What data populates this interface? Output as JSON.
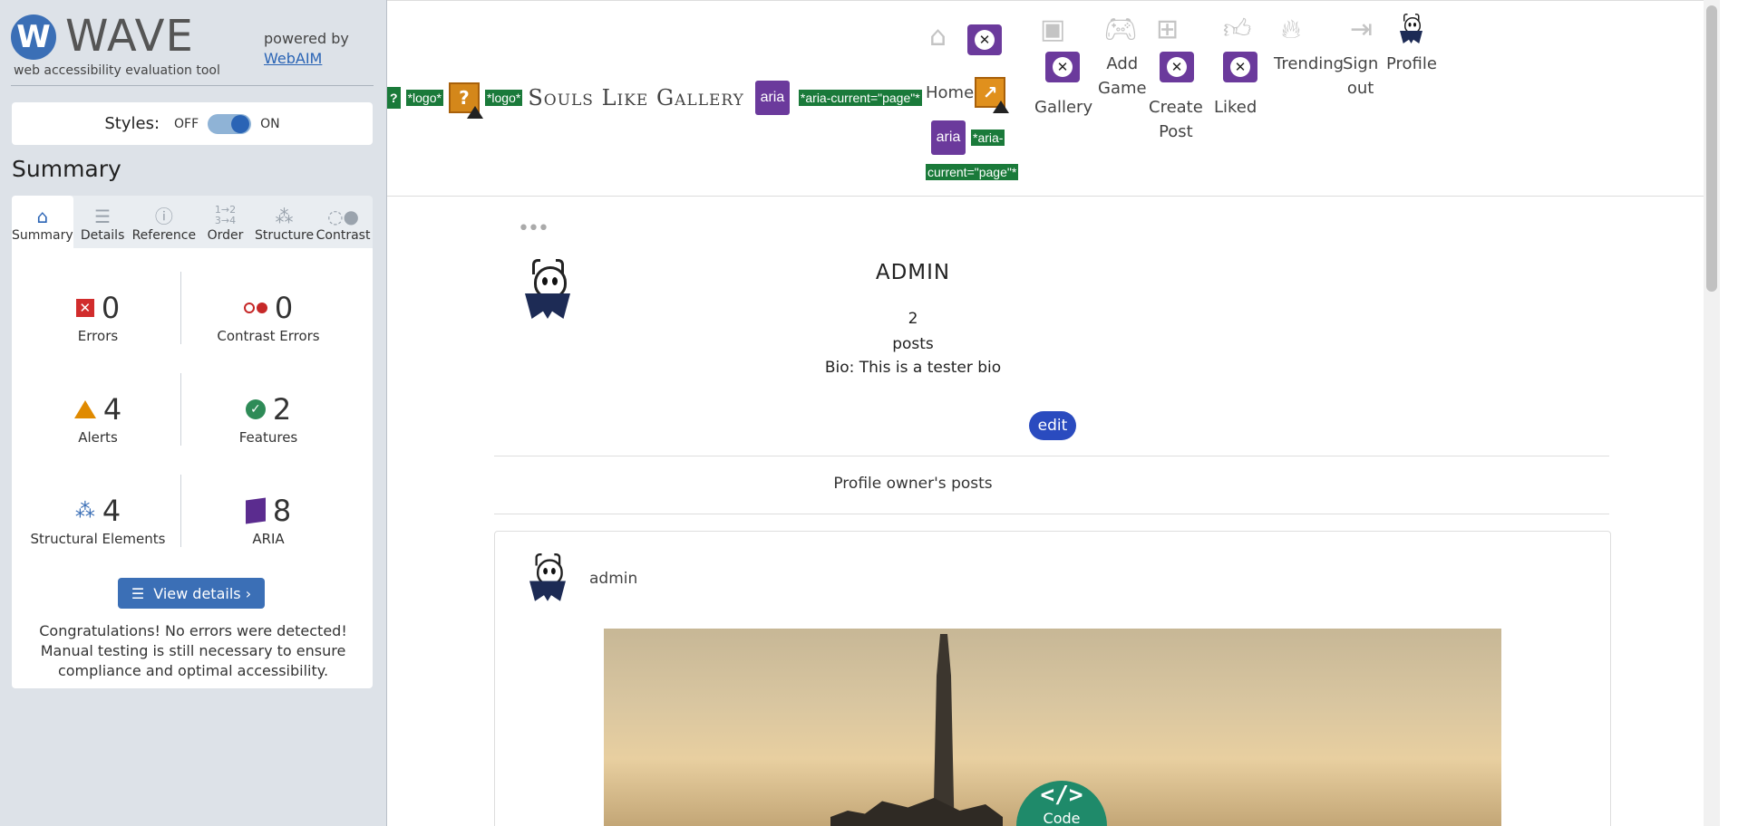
{
  "wave": {
    "logo_letter": "W",
    "logo_text": "WAVE",
    "tagline": "web accessibility evaluation tool",
    "powered_by": "powered by",
    "powered_link": "WebAIM",
    "styles_label": "Styles:",
    "styles_off": "OFF",
    "styles_on": "ON",
    "summary_heading": "Summary",
    "tabs": [
      {
        "label": "Summary",
        "icon": "home-icon",
        "active": true
      },
      {
        "label": "Details",
        "icon": "list-icon",
        "active": false
      },
      {
        "label": "Reference",
        "icon": "info-icon",
        "active": false
      },
      {
        "label": "Order",
        "icon": "order-icon",
        "active": false
      },
      {
        "label": "Structure",
        "icon": "structure-icon",
        "active": false
      },
      {
        "label": "Contrast",
        "icon": "contrast-icon",
        "active": false
      }
    ],
    "stats": {
      "errors": {
        "count": "0",
        "label": "Errors"
      },
      "contrast_errors": {
        "count": "0",
        "label": "Contrast Errors"
      },
      "alerts": {
        "count": "4",
        "label": "Alerts"
      },
      "features": {
        "count": "2",
        "label": "Features"
      },
      "structural": {
        "count": "4",
        "label": "Structural Elements"
      },
      "aria": {
        "count": "8",
        "label": "ARIA"
      }
    },
    "view_details": "View details ›",
    "congrats": "Congratulations! No errors were detected! Manual testing is still necessary to ensure compliance and optimal accessibility."
  },
  "site": {
    "wave_logo_badge_1": "*logo*",
    "wave_logo_badge_2": "*logo*",
    "brand_title": "Souls Like Gallery",
    "aria_label": "aria",
    "aria_current_badge": "*aria-current=\"page\"*",
    "aria_current_badge_split_1": "*aria-",
    "aria_current_badge_split_2": "current=\"page\"*",
    "question_mark": "?",
    "nav": {
      "home": "Home",
      "gallery": "Gallery",
      "add_game_1": "Add",
      "add_game_2": "Game",
      "create_post_1": "Create",
      "create_post_2": "Post",
      "liked": "Liked",
      "trending": "Trending",
      "sign_out_1": "Sign",
      "sign_out_2": "out",
      "profile": "Profile"
    },
    "menu_dots": "•••",
    "profile_name": "ADMIN",
    "post_count": "2",
    "posts_word": "posts",
    "bio": "Bio: This is a tester bio",
    "edit": "edit",
    "owner_posts": "Profile owner's posts",
    "post_author": "admin",
    "code_glyph": "</>",
    "code_label": "Code"
  },
  "colors": {
    "wave_blue": "#3b6fb6",
    "wave_green_badge": "#1a7a3a",
    "aria_purple": "#6b3a9c",
    "edit_blue": "#2a4bbf",
    "code_tab": "#1f8a6a"
  }
}
